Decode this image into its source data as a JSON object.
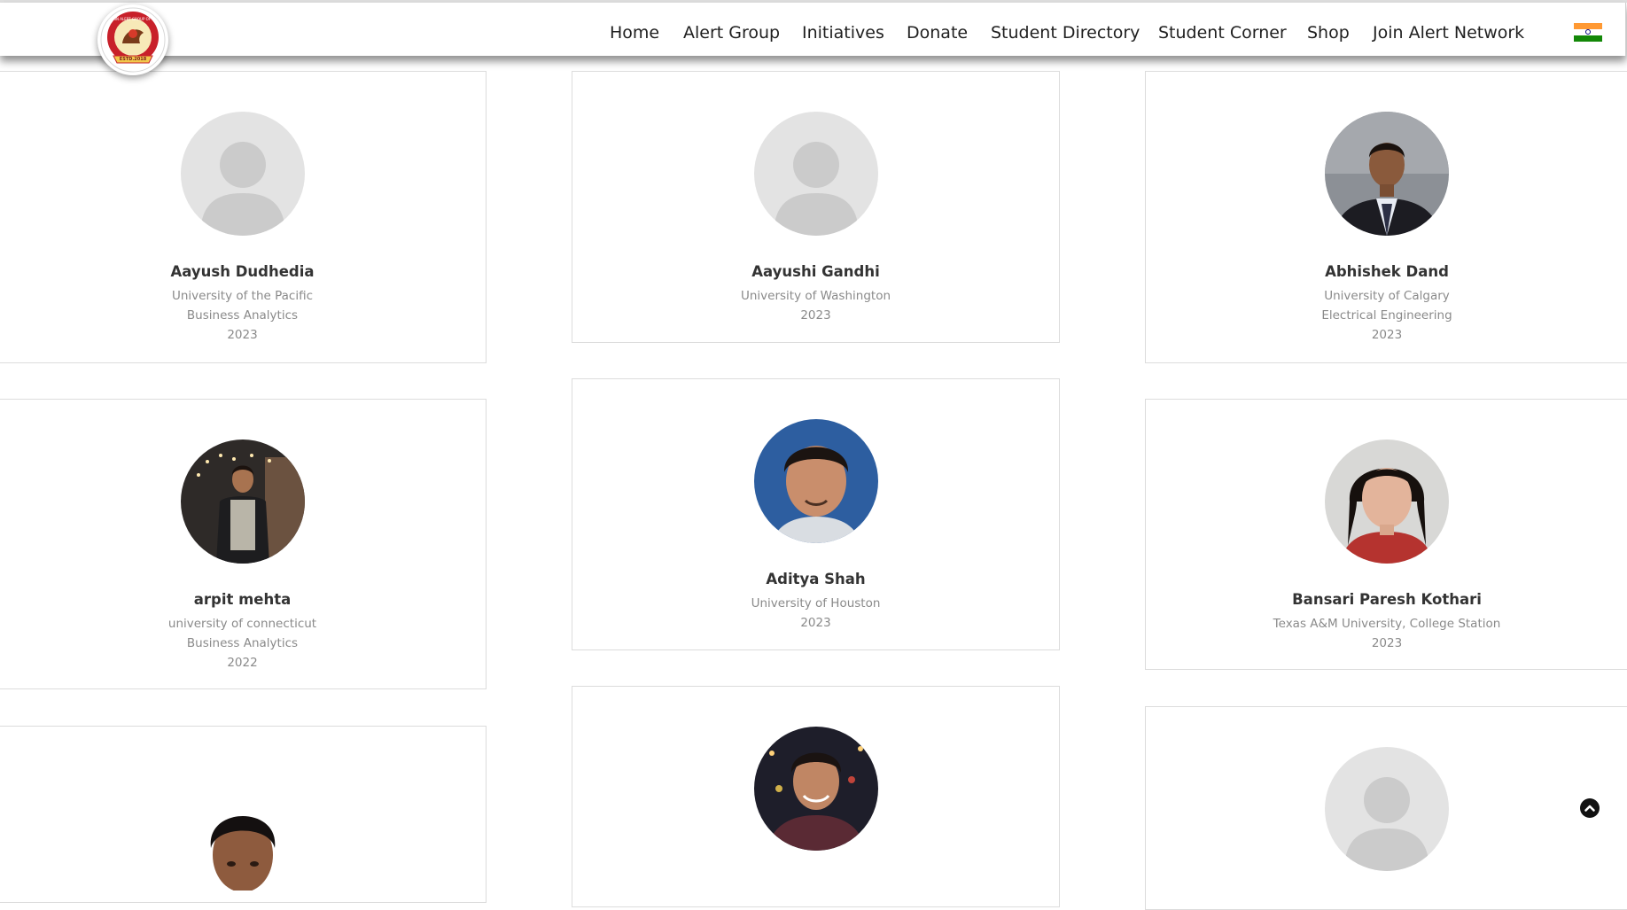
{
  "nav": {
    "items": [
      {
        "label": "Home"
      },
      {
        "label": "Alert Group"
      },
      {
        "label": "Initiatives"
      },
      {
        "label": "Donate"
      },
      {
        "label": "Student Directory"
      },
      {
        "label": "Student Corner"
      },
      {
        "label": "Shop"
      },
      {
        "label": "Join Alert Network"
      }
    ],
    "flag_colors": [
      "#FF9933",
      "#FFFFFF",
      "#138808"
    ]
  },
  "logo": {
    "top_text": "JAIN ALERT GROUP OF USA",
    "bottom_text": "ESTD.2018"
  },
  "students": [
    {
      "name": "Aayush Dudhedia",
      "university": "University of the Pacific",
      "major": "Business Analytics",
      "year": "2023",
      "photo": "placeholder"
    },
    {
      "name": "Aayushi Gandhi",
      "university": "University of Washington",
      "major": "",
      "year": "2023",
      "photo": "placeholder"
    },
    {
      "name": "Abhishek Dand",
      "university": "University of Calgary",
      "major": "Electrical Engineering",
      "year": "2023",
      "photo": "portrait"
    },
    {
      "name": "arpit mehta",
      "university": "university of connecticut",
      "major": "Business Analytics",
      "year": "2022",
      "photo": "portrait"
    },
    {
      "name": "Aditya Shah",
      "university": "University of Houston",
      "major": "",
      "year": "2023",
      "photo": "portrait"
    },
    {
      "name": "Bansari Paresh Kothari",
      "university": "Texas A&M University, College Station",
      "major": "",
      "year": "2023",
      "photo": "portrait"
    },
    {
      "name": "",
      "university": "",
      "major": "",
      "year": "",
      "photo": "portrait"
    },
    {
      "name": "",
      "university": "",
      "major": "",
      "year": "",
      "photo": "portrait"
    },
    {
      "name": "",
      "university": "",
      "major": "",
      "year": "",
      "photo": "placeholder"
    }
  ],
  "icons": {
    "scroll_top": "chevron-up-circle-icon",
    "placeholder_avatar": "user-silhouette-icon"
  }
}
